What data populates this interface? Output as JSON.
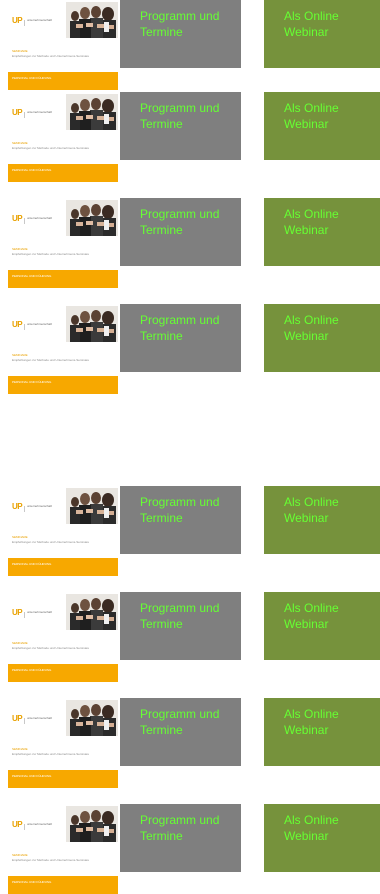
{
  "rows": [
    {
      "programm": "Programm und Termine",
      "online": "Als Online Webinar"
    },
    {
      "programm": "Programm und Termine",
      "online": "Als Online Webinar"
    },
    {
      "programm": "Programm und Termine",
      "online": "Als Online Webinar"
    },
    {
      "programm": "Programm und Termine",
      "online": "Als Online Webinar"
    },
    {
      "programm": "Programm und Termine",
      "online": "Als Online Webinar"
    },
    {
      "programm": "Programm und Termine",
      "online": "Als Online Webinar"
    },
    {
      "programm": "Programm und Termine",
      "online": "Als Online Webinar"
    },
    {
      "programm": "Programm und Termine",
      "online": "Als Online Webinar"
    }
  ],
  "thumb": {
    "logo_mark": "UP",
    "brand": "unternehmerschaft",
    "title": "SEMINARE",
    "subtitle": "Empfehlungen zur Methode und Unternehmens-Seminare",
    "footer_left_1": "PERSONAL UND FÜHRUNG",
    "footer_left_2": "",
    "footer_right_1": "",
    "footer_right_2": ""
  },
  "colors": {
    "programm_bg": "#7f7f7f",
    "online_bg": "#76923c",
    "button_text": "#66ff33",
    "footer_orange": "#f7a800"
  }
}
